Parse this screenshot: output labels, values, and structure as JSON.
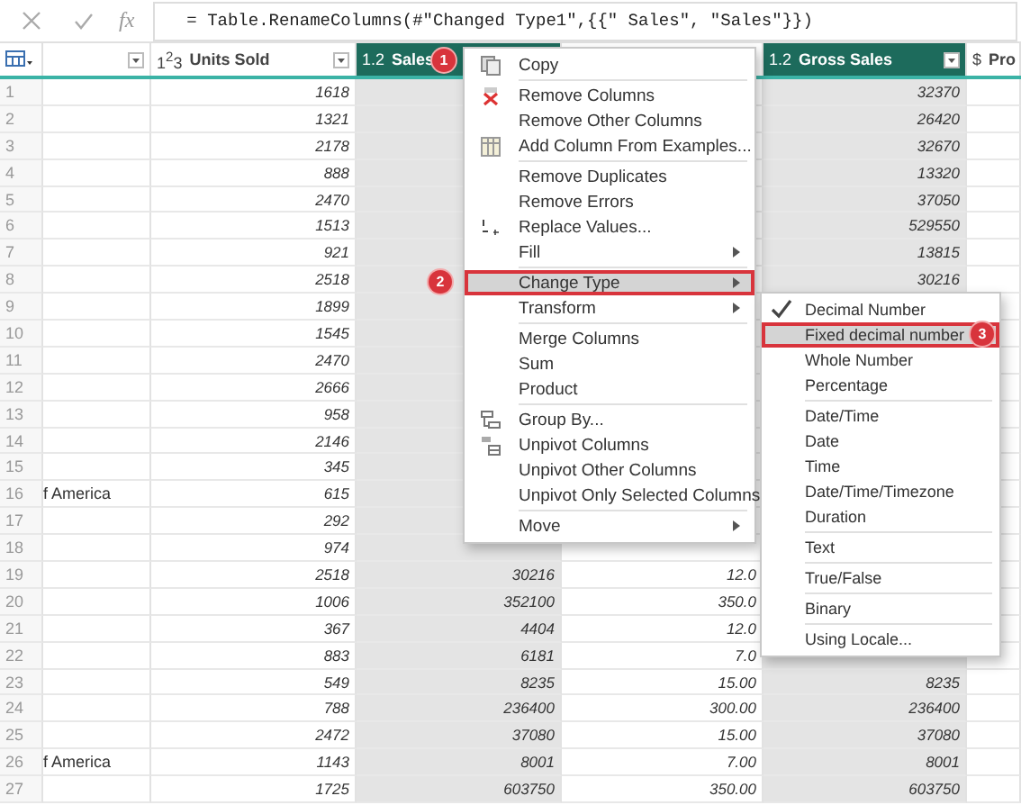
{
  "formula_bar": {
    "fx": "fx",
    "formula": "= Table.RenameColumns(#\"Changed Type1\",{{\" Sales\", \"Sales\"}})"
  },
  "table": {
    "columns": [
      {
        "selected": false,
        "dropdown": true
      },
      {
        "type": "1$^{2}$3",
        "label": "Units Sold",
        "selected": false,
        "dropdown": true
      },
      {
        "type": "1.2",
        "label": "Sales",
        "selected": true,
        "dropdown": false,
        "badge": "1"
      },
      {
        "selected": false,
        "dropdown": false
      },
      {
        "type": "1.2",
        "label": "Gross Sales",
        "selected": true,
        "dropdown": true
      },
      {
        "type": "$",
        "label": "Pro",
        "selected": false,
        "dropdown": false
      }
    ],
    "rows": [
      {
        "number": "1",
        "units_sold": "1618",
        "gross_sales": "32370"
      },
      {
        "number": "2",
        "units_sold": "1321",
        "gross_sales": "26420"
      },
      {
        "number": "3",
        "units_sold": "2178",
        "gross_sales": "32670"
      },
      {
        "number": "4",
        "units_sold": "888",
        "gross_sales": "13320"
      },
      {
        "number": "5",
        "units_sold": "2470",
        "gross_sales": "37050"
      },
      {
        "number": "6",
        "units_sold": "1513",
        "gross_sales": "529550"
      },
      {
        "number": "7",
        "units_sold": "921",
        "gross_sales": "13815"
      },
      {
        "number": "8",
        "units_sold": "2518",
        "gross_sales": "30216"
      },
      {
        "number": "9",
        "units_sold": "1899"
      },
      {
        "number": "10",
        "units_sold": "1545"
      },
      {
        "number": "11",
        "units_sold": "2470"
      },
      {
        "number": "12",
        "units_sold": "2666"
      },
      {
        "number": "13",
        "units_sold": "958"
      },
      {
        "number": "14",
        "units_sold": "2146"
      },
      {
        "number": "15",
        "units_sold": "345"
      },
      {
        "number": "16",
        "column_1": "f America",
        "units_sold": "615"
      },
      {
        "number": "17",
        "units_sold": "292"
      },
      {
        "number": "18",
        "units_sold": "974"
      },
      {
        "number": "19",
        "units_sold": "2518",
        "sales": "30216",
        "column_4": "12.0"
      },
      {
        "number": "20",
        "units_sold": "1006",
        "sales": "352100",
        "column_4": "350.0"
      },
      {
        "number": "21",
        "units_sold": "367",
        "sales": "4404",
        "column_4": "12.0"
      },
      {
        "number": "22",
        "units_sold": "883",
        "sales": "6181",
        "column_4": "7.0"
      },
      {
        "number": "23",
        "units_sold": "549",
        "sales": "8235",
        "column_4": "15.00",
        "gross_sales": "8235"
      },
      {
        "number": "24",
        "units_sold": "788",
        "sales": "236400",
        "column_4": "300.00",
        "gross_sales": "236400"
      },
      {
        "number": "25",
        "units_sold": "2472",
        "sales": "37080",
        "column_4": "15.00",
        "gross_sales": "37080"
      },
      {
        "number": "26",
        "column_1": "f America",
        "units_sold": "1143",
        "sales": "8001",
        "column_4": "7.00",
        "gross_sales": "8001"
      },
      {
        "number": "27",
        "units_sold": "1725",
        "sales": "603750",
        "column_4": "350.00",
        "gross_sales": "603750"
      }
    ]
  },
  "context_menu": {
    "groups": [
      [
        {
          "label": "Copy",
          "kind": "copy",
          "submenu": false,
          "highlighted": false
        }
      ],
      [
        {
          "label": "Remove Columns",
          "kind": "remove",
          "submenu": false,
          "highlighted": false
        },
        {
          "label": "Remove Other Columns",
          "kind": "plain",
          "submenu": false,
          "highlighted": false
        },
        {
          "label": "Add Column From Examples...",
          "kind": "table",
          "submenu": false,
          "highlighted": false
        }
      ],
      [
        {
          "label": "Remove Duplicates",
          "kind": "plain",
          "submenu": false,
          "highlighted": false
        },
        {
          "label": "Remove Errors",
          "kind": "plain",
          "submenu": false,
          "highlighted": false
        },
        {
          "label": "Replace Values...",
          "kind": "replace",
          "submenu": false,
          "highlighted": false
        },
        {
          "label": "Fill",
          "kind": "plain",
          "submenu": true,
          "highlighted": false
        }
      ],
      [
        {
          "label": "Change Type",
          "kind": "plain",
          "submenu": true,
          "highlighted": true,
          "badge": "2"
        },
        {
          "label": "Transform",
          "kind": "plain",
          "submenu": true,
          "highlighted": false
        }
      ],
      [
        {
          "label": "Merge Columns",
          "kind": "plain",
          "submenu": false,
          "highlighted": false
        },
        {
          "label": "Sum",
          "kind": "plain",
          "submenu": false,
          "highlighted": false
        },
        {
          "label": "Product",
          "kind": "plain",
          "submenu": false,
          "highlighted": false
        }
      ],
      [
        {
          "label": "Group By...",
          "kind": "group",
          "submenu": false,
          "highlighted": false
        },
        {
          "label": "Unpivot Columns",
          "kind": "unpivot",
          "submenu": false,
          "highlighted": false
        },
        {
          "label": "Unpivot Other Columns",
          "kind": "plain",
          "submenu": false,
          "highlighted": false
        },
        {
          "label": "Unpivot Only Selected Columns",
          "kind": "plain",
          "submenu": false,
          "highlighted": false
        }
      ],
      [
        {
          "label": "Move",
          "kind": "plain",
          "submenu": true,
          "highlighted": false
        }
      ]
    ]
  },
  "type_submenu": {
    "groups": [
      [
        {
          "label": "Decimal Number",
          "checked": true,
          "highlighted": false
        },
        {
          "label": "Fixed decimal number",
          "checked": false,
          "highlighted": true,
          "badge": "3"
        },
        {
          "label": "Whole Number",
          "checked": false,
          "highlighted": false
        },
        {
          "label": "Percentage",
          "checked": false,
          "highlighted": false
        }
      ],
      [
        {
          "label": "Date/Time",
          "checked": false,
          "highlighted": false
        },
        {
          "label": "Date",
          "checked": false,
          "highlighted": false
        },
        {
          "label": "Time",
          "checked": false,
          "highlighted": false
        },
        {
          "label": "Date/Time/Timezone",
          "checked": false,
          "highlighted": false
        },
        {
          "label": "Duration",
          "checked": false,
          "highlighted": false
        }
      ],
      [
        {
          "label": "Text",
          "checked": false,
          "highlighted": false
        }
      ],
      [
        {
          "label": "True/False",
          "checked": false,
          "highlighted": false
        }
      ],
      [
        {
          "label": "Binary",
          "checked": false,
          "highlighted": false
        }
      ],
      [
        {
          "label": "Using Locale...",
          "checked": false,
          "highlighted": false
        }
      ]
    ]
  }
}
